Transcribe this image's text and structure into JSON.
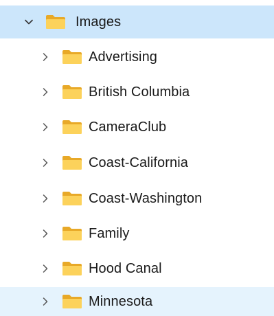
{
  "tree": {
    "root": {
      "label": "Images",
      "icon": "folder-icon",
      "expanded": true,
      "selected_color": "#cce6fb"
    },
    "children": [
      {
        "label": "Advertising",
        "icon": "folder-icon"
      },
      {
        "label": "British Columbia",
        "icon": "folder-icon"
      },
      {
        "label": "CameraClub",
        "icon": "folder-icon"
      },
      {
        "label": "Coast-California",
        "icon": "folder-icon"
      },
      {
        "label": "Coast-Washington",
        "icon": "folder-icon"
      },
      {
        "label": "Family",
        "icon": "folder-icon"
      },
      {
        "label": "Hood Canal",
        "icon": "folder-icon"
      },
      {
        "label": "Minnesota",
        "icon": "folder-icon",
        "hovered": true
      }
    ],
    "hover_color": "#e5f3fd",
    "folder_color": "#f8c848"
  }
}
